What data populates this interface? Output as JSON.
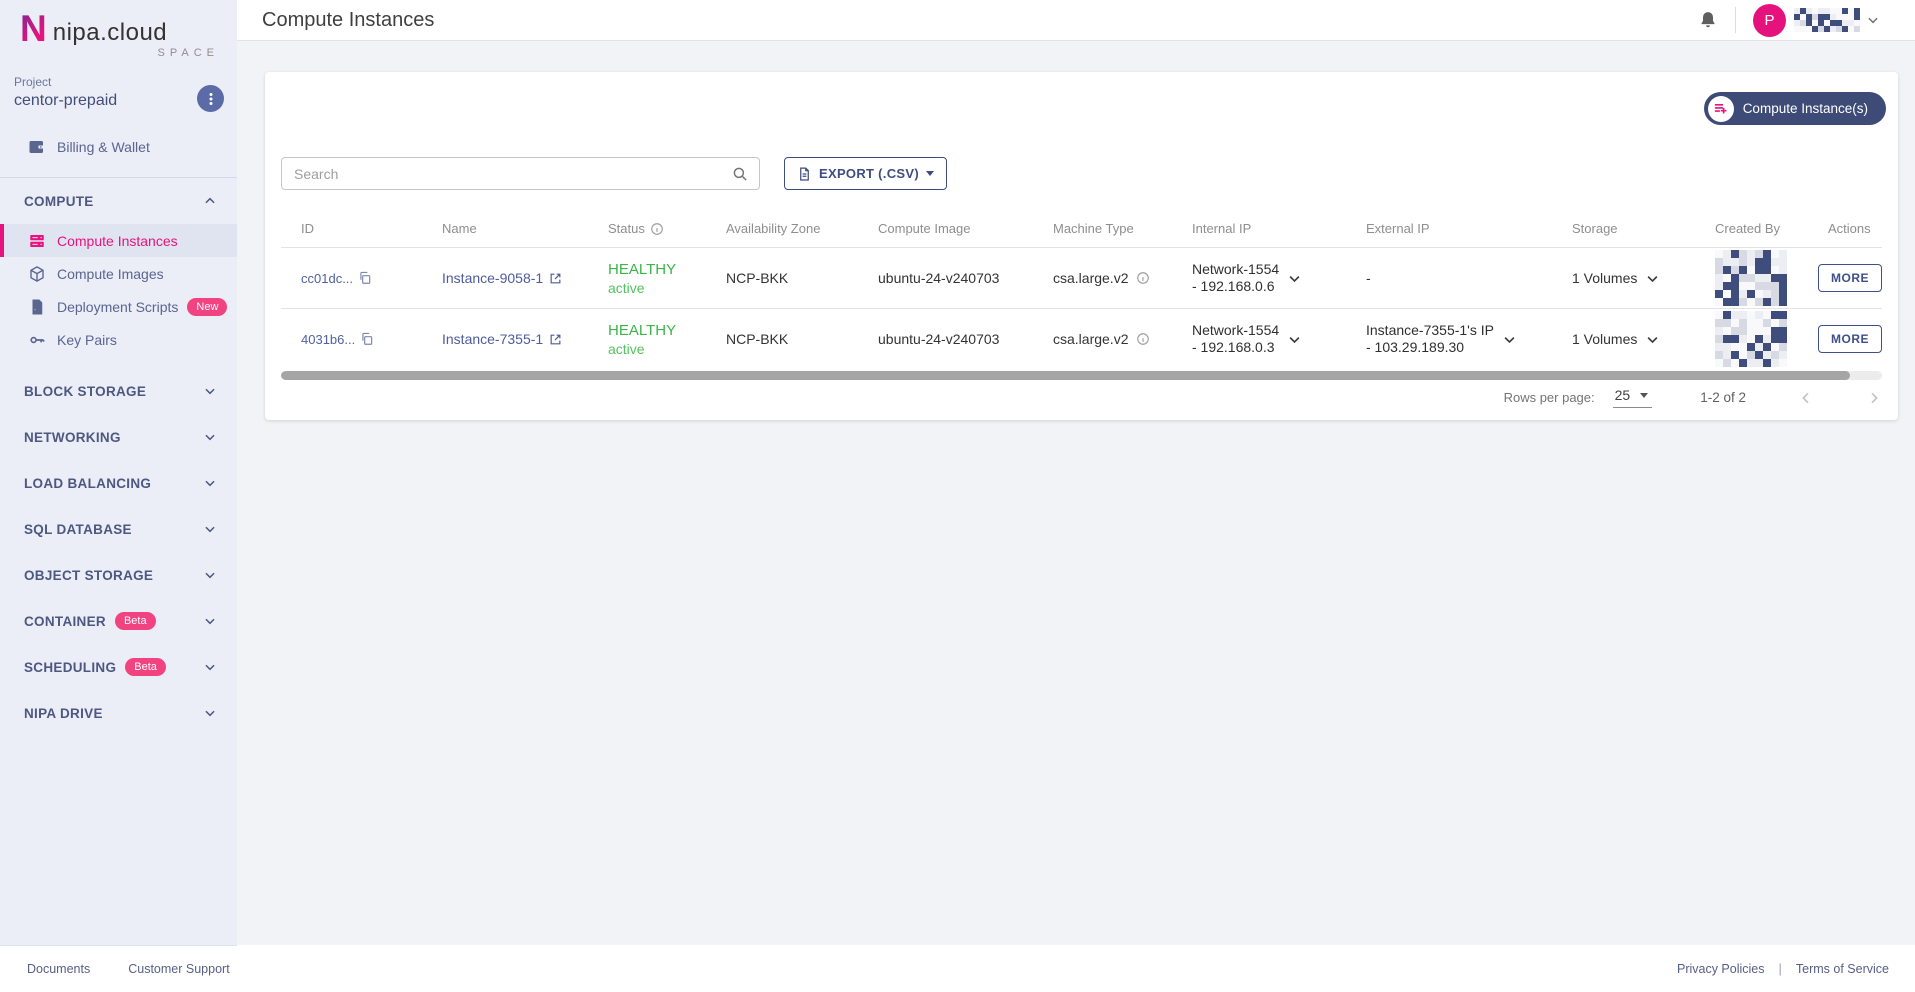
{
  "brand": {
    "n": "N",
    "name": "nipa.cloud",
    "sub": "SPACE"
  },
  "sidebar": {
    "project_label": "Project",
    "project_name": "centor-prepaid",
    "billing": {
      "label": "Billing & Wallet"
    },
    "compute": {
      "label": "COMPUTE",
      "items": [
        {
          "label": "Compute Instances"
        },
        {
          "label": "Compute Images"
        },
        {
          "label": "Deployment Scripts",
          "badge": "New"
        },
        {
          "label": "Key Pairs"
        }
      ]
    },
    "sections": [
      {
        "label": "BLOCK STORAGE"
      },
      {
        "label": "NETWORKING"
      },
      {
        "label": "LOAD BALANCING"
      },
      {
        "label": "SQL DATABASE"
      },
      {
        "label": "OBJECT STORAGE"
      },
      {
        "label": "CONTAINER",
        "badge": "Beta"
      },
      {
        "label": "SCHEDULING",
        "badge": "Beta"
      },
      {
        "label": "NIPA DRIVE"
      }
    ]
  },
  "header": {
    "title": "Compute Instances",
    "avatar_initial": "P"
  },
  "toolbar": {
    "create_button": "Compute Instance(s)",
    "search_placeholder": "Search",
    "export_button": "EXPORT (.CSV)"
  },
  "table": {
    "columns": [
      "ID",
      "Name",
      "Status",
      "Availability Zone",
      "Compute Image",
      "Machine Type",
      "Internal IP",
      "External IP",
      "Storage",
      "Created By",
      "Actions"
    ],
    "rows": [
      {
        "id": "cc01dc...",
        "name": "Instance-9058-1",
        "status": "HEALTHY",
        "sub_status": "active",
        "zone": "NCP-BKK",
        "image": "ubuntu-24-v240703",
        "machine": "csa.large.v2",
        "internal_ip_line1": "Network-1554",
        "internal_ip_line2": "- 192.168.0.6",
        "external_ip_line1": "-",
        "external_ip_line2": "",
        "storage": "1 Volumes",
        "more": "MORE"
      },
      {
        "id": "4031b6...",
        "name": "Instance-7355-1",
        "status": "HEALTHY",
        "sub_status": "active",
        "zone": "NCP-BKK",
        "image": "ubuntu-24-v240703",
        "machine": "csa.large.v2",
        "internal_ip_line1": "Network-1554",
        "internal_ip_line2": "- 192.168.0.3",
        "external_ip_line1": "Instance-7355-1's IP",
        "external_ip_line2": "- 103.29.189.30",
        "storage": "1 Volumes",
        "more": "MORE"
      }
    ]
  },
  "pagination": {
    "rows_label": "Rows per page:",
    "rows_value": "25",
    "range": "1-2 of 2"
  },
  "footer": {
    "left": [
      "Documents",
      "Customer Support"
    ],
    "right": [
      "Privacy Policies",
      "Terms of Service"
    ]
  },
  "icons": [
    "kebab-icon",
    "wallet-icon",
    "server-icon",
    "cube-icon",
    "script-icon",
    "key-icon",
    "chevron-up-icon",
    "chevron-down-icon",
    "bell-icon",
    "search-icon",
    "export-file-icon",
    "playlist-add-icon",
    "copy-icon",
    "external-link-icon",
    "info-icon",
    "chevron-left-icon",
    "chevron-right-icon"
  ],
  "colors": {
    "accent_pink": "#e7137c",
    "navy": "#3d4b76",
    "link_blue": "#4d5c9b",
    "status_green": "#3cb44a",
    "sidebar_bg": "#ebedf7"
  }
}
